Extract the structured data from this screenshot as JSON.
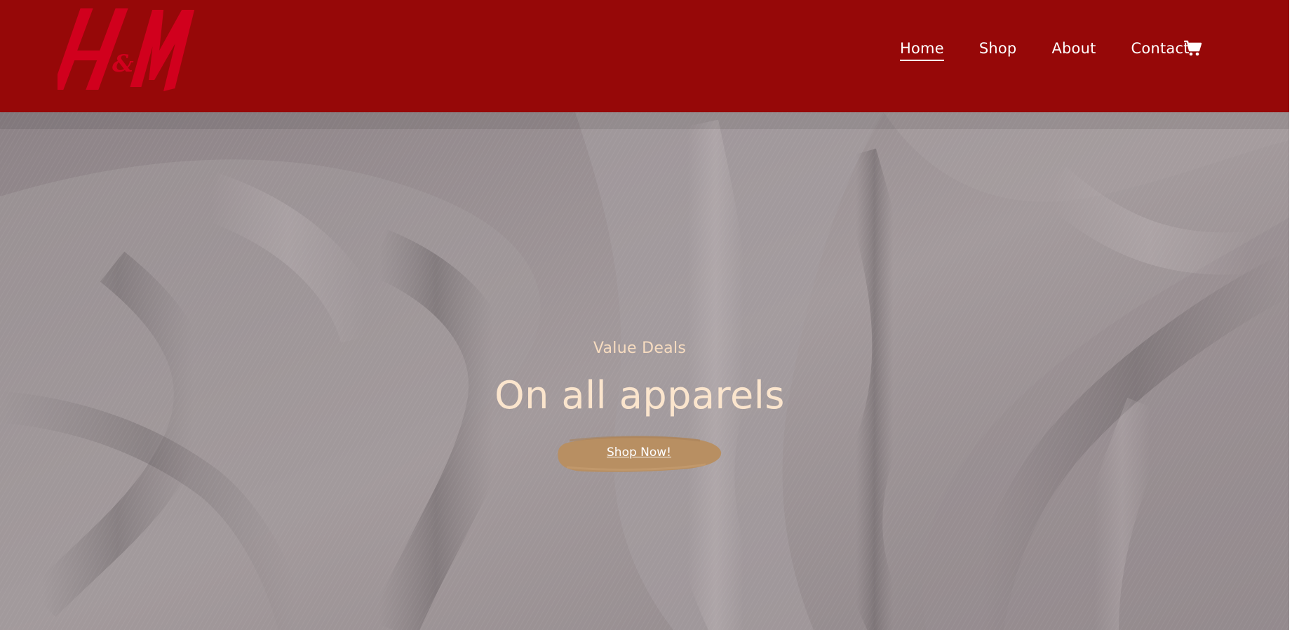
{
  "brand": {
    "logo_text": "H&M",
    "logo_color": "#d1001d"
  },
  "header": {
    "background": "#960808",
    "nav": [
      {
        "label": "Home",
        "active": true
      },
      {
        "label": "Shop",
        "active": false
      },
      {
        "label": "About",
        "active": false
      },
      {
        "label": "Contact",
        "active": false
      }
    ],
    "cart_icon": "shopping-cart-icon"
  },
  "hero": {
    "background_image": "grey draped fabric",
    "subtitle": "Value Deals",
    "title": "On all apparels",
    "cta_label": "Shop Now!",
    "cta_color": "#b88f62",
    "text_color": "#fbe5cd"
  }
}
